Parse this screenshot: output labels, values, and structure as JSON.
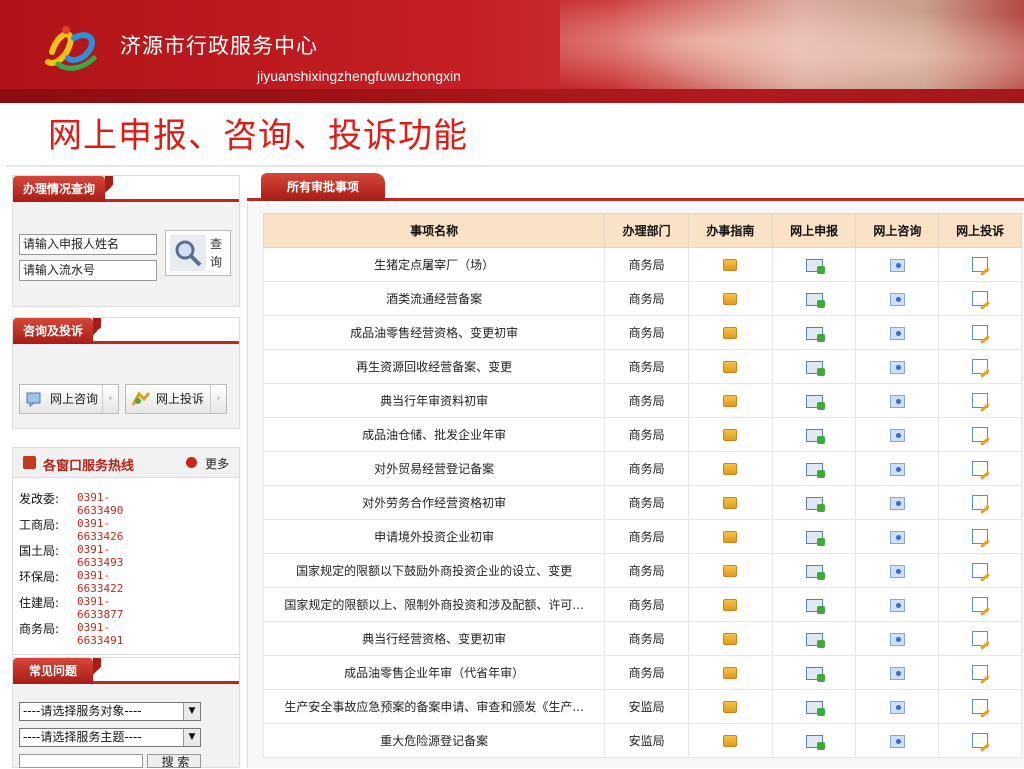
{
  "header": {
    "center_name": "济源市行政服务中心",
    "pinyin": "jiyuanshixingzhengfuwuzhongxin"
  },
  "slide_title": "网上申报、咨询、投诉功能",
  "sidebar": {
    "query": {
      "title": "办理情况查询",
      "name_input": "请输入申报人姓名",
      "serial_input": "请输入流水号",
      "search_label": "查询"
    },
    "consult": {
      "title": "咨询及投诉",
      "consult_button": "网上咨询",
      "complain_button": "网上投诉"
    },
    "hotline": {
      "title": "各窗口服务热线",
      "more": "更多",
      "items": [
        {
          "dept": "发改委:",
          "phone": "0391-6633490"
        },
        {
          "dept": "工商局:",
          "phone": "0391-6633426"
        },
        {
          "dept": "国土局:",
          "phone": "0391-6633493"
        },
        {
          "dept": "环保局:",
          "phone": "0391-6633422"
        },
        {
          "dept": "住建局:",
          "phone": "0391-6633877"
        },
        {
          "dept": "商务局:",
          "phone": "0391-6633491"
        }
      ]
    },
    "faq": {
      "title": "常见问题",
      "select_object": "----请选择服务对象----",
      "select_topic": "----请选择服务主题----",
      "search_button": "搜 索"
    }
  },
  "main": {
    "tab": "所有审批事项",
    "columns": [
      "事项名称",
      "办理部门",
      "办事指南",
      "网上申报",
      "网上咨询",
      "网上投诉"
    ],
    "rows": [
      {
        "name": "生猪定点屠宰厂（场）",
        "dept": "商务局"
      },
      {
        "name": "酒类流通经营备案",
        "dept": "商务局"
      },
      {
        "name": "成品油零售经营资格、变更初审",
        "dept": "商务局"
      },
      {
        "name": "再生资源回收经营备案、变更",
        "dept": "商务局"
      },
      {
        "name": "典当行年审资料初审",
        "dept": "商务局"
      },
      {
        "name": "成品油仓储、批发企业年审",
        "dept": "商务局"
      },
      {
        "name": "对外贸易经营登记备案",
        "dept": "商务局"
      },
      {
        "name": "对外劳务合作经营资格初审",
        "dept": "商务局"
      },
      {
        "name": "申请境外投资企业初审",
        "dept": "商务局"
      },
      {
        "name": "国家规定的限额以下鼓励外商投资企业的设立、变更",
        "dept": "商务局"
      },
      {
        "name": "国家规定的限额以上、限制外商投资和涉及配额、许可...",
        "dept": "商务局"
      },
      {
        "name": "典当行经营资格、变更初审",
        "dept": "商务局"
      },
      {
        "name": "成品油零售企业年审（代省年审）",
        "dept": "商务局"
      },
      {
        "name": "生产安全事故应急预案的备案申请、审查和颁发《生产...",
        "dept": "安监局"
      },
      {
        "name": "重大危险源登记备案",
        "dept": "安监局"
      }
    ]
  }
}
